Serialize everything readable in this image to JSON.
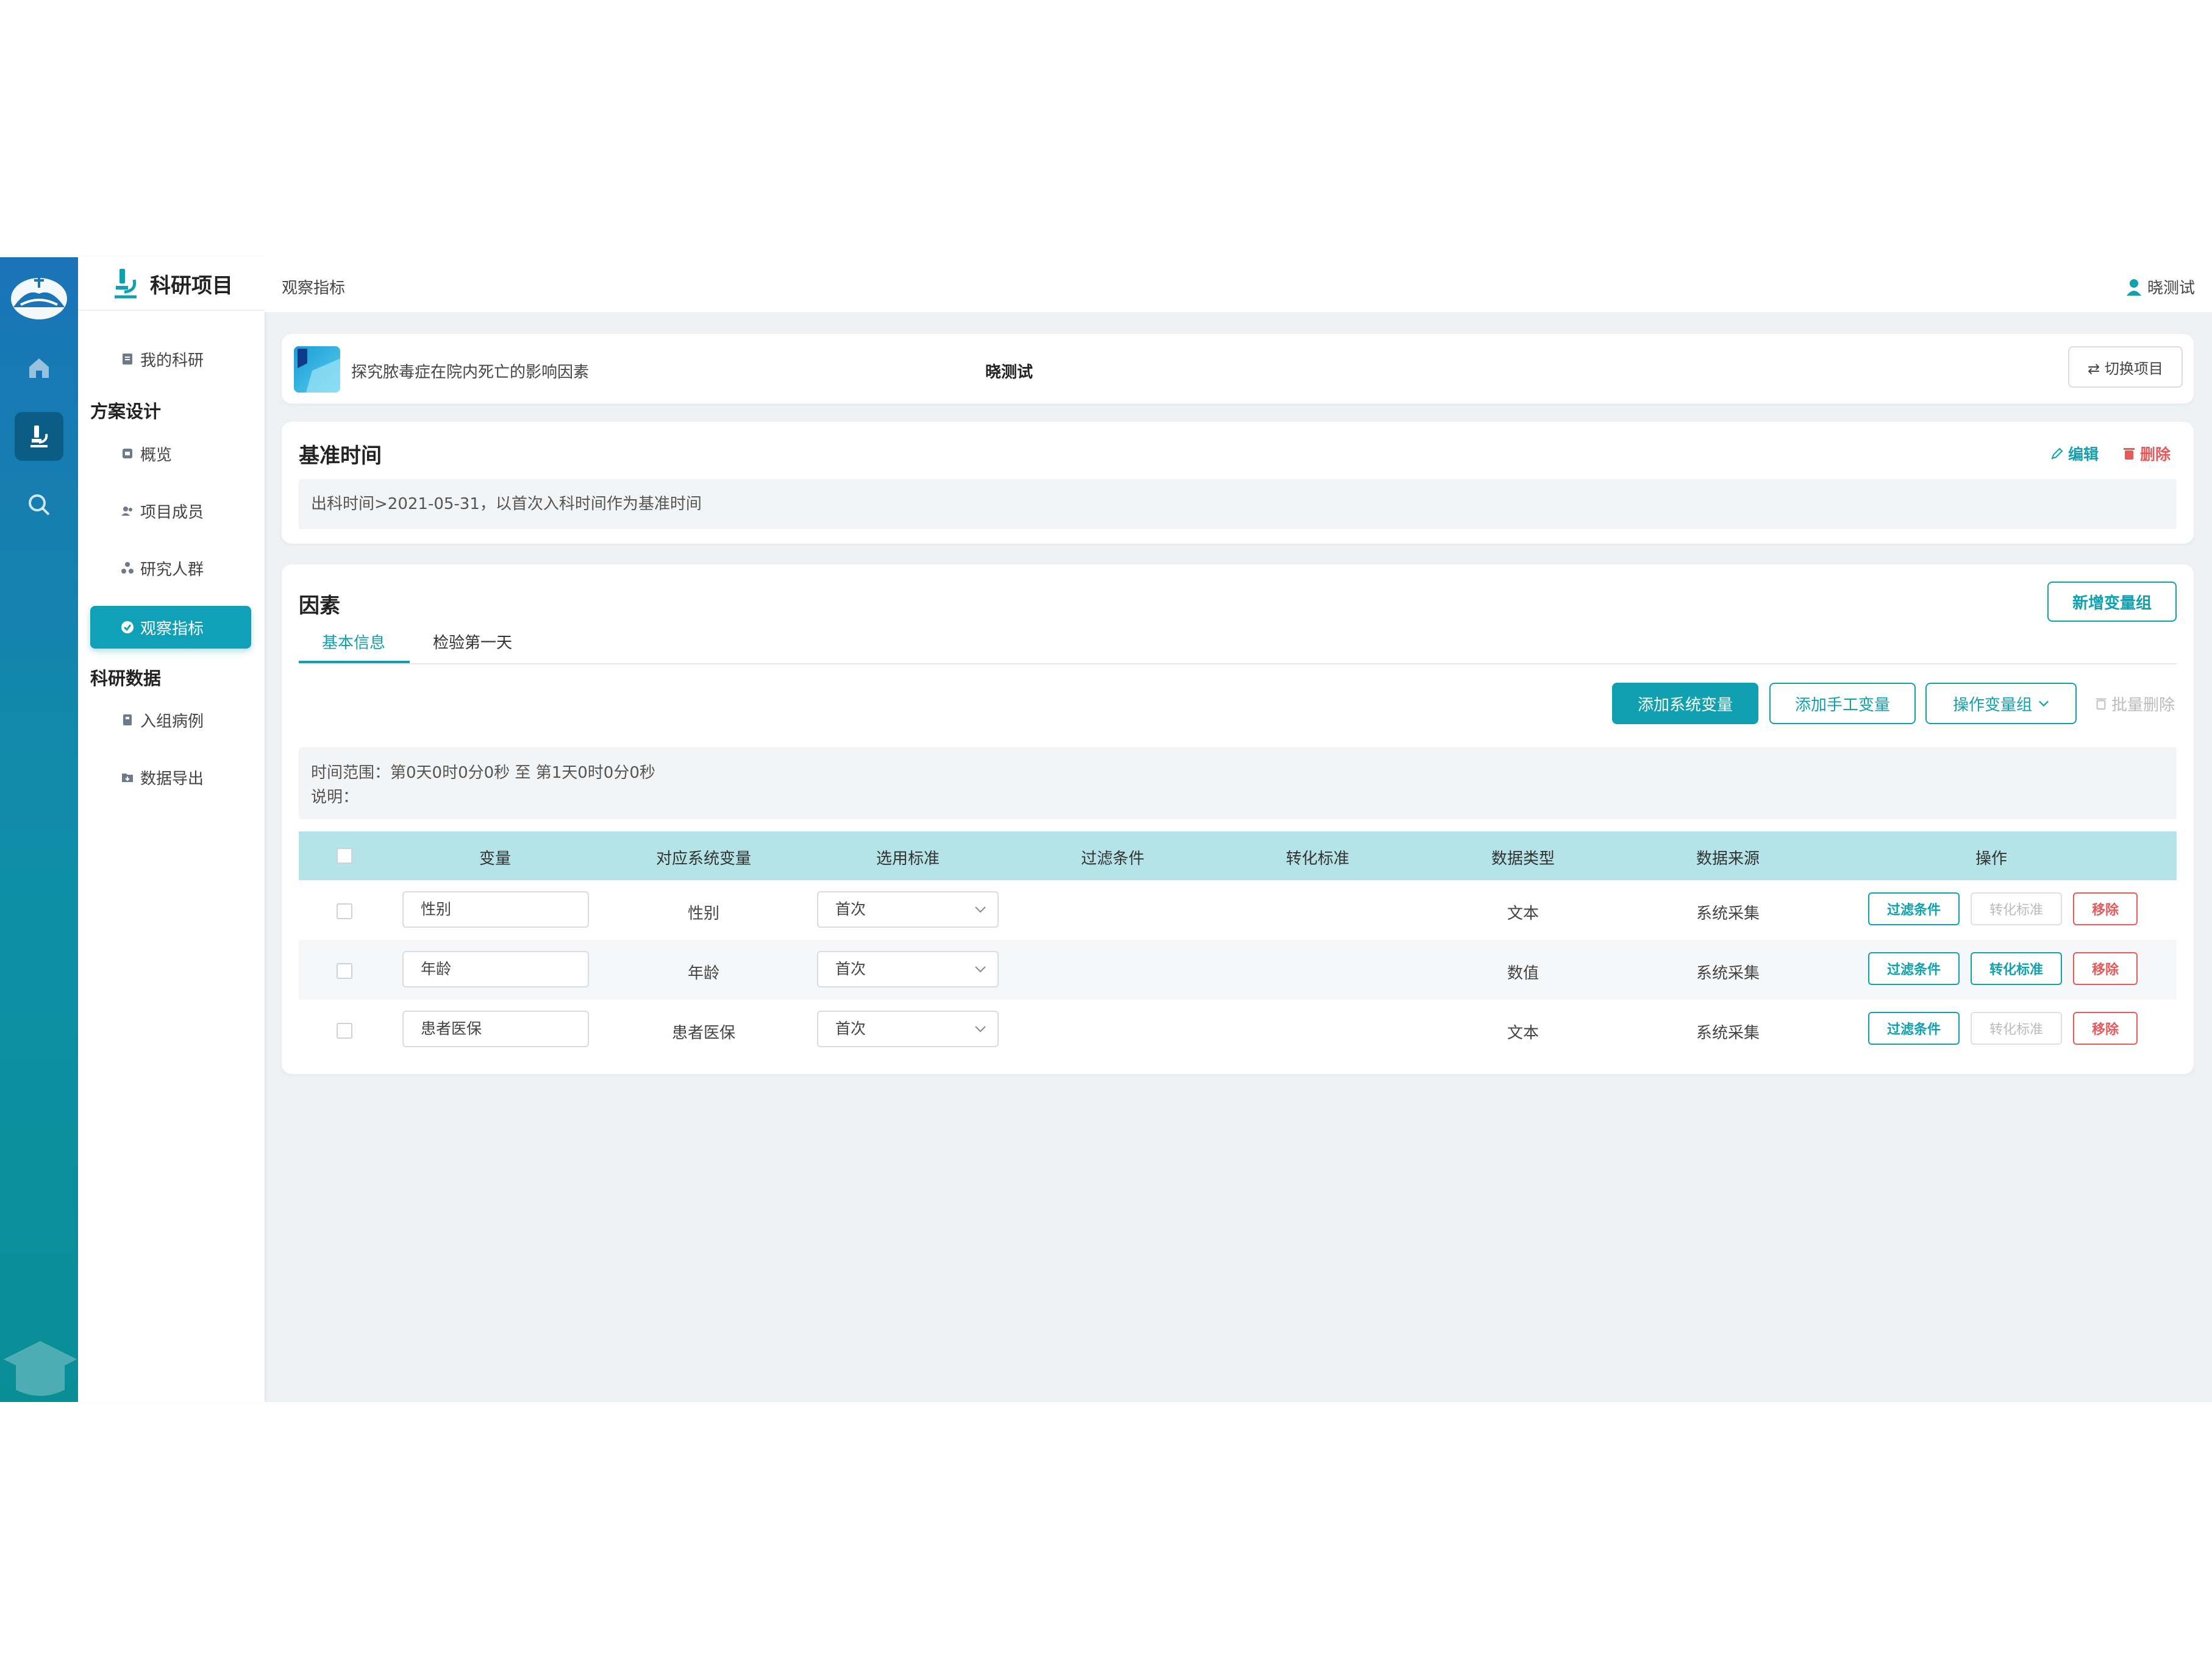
{
  "colors": {
    "accent": "#10a0b0",
    "danger": "#e85a5a",
    "header_row": "#b4e3e8",
    "rail": "#1a74b7"
  },
  "rail": {
    "items": [
      "home-icon",
      "microscope-icon",
      "search-icon"
    ],
    "active": "microscope-icon"
  },
  "sidebar": {
    "title": "科研项目",
    "my_research": "我的科研",
    "section_design": "方案设计",
    "design_items": [
      {
        "label": "概览",
        "icon": "overview-icon"
      },
      {
        "label": "项目成员",
        "icon": "members-icon"
      },
      {
        "label": "研究人群",
        "icon": "population-icon"
      },
      {
        "label": "观察指标",
        "icon": "indicator-icon",
        "active": true
      }
    ],
    "section_data": "科研数据",
    "data_items": [
      {
        "label": "入组病例",
        "icon": "cases-icon"
      },
      {
        "label": "数据导出",
        "icon": "export-icon"
      }
    ]
  },
  "header": {
    "breadcrumb": "观察指标",
    "user": "晓测试"
  },
  "project": {
    "name": "探究脓毒症在院内死亡的影响因素",
    "owner": "晓测试",
    "switch_label": "⇄ 切换项目"
  },
  "baseline": {
    "title": "基准时间",
    "edit_label": "编辑",
    "delete_label": "删除",
    "description": "出科时间>2021-05-31，以首次入科时间作为基准时间"
  },
  "factors": {
    "title": "因素",
    "add_group_label": "新增变量组",
    "tabs": [
      "基本信息",
      "检验第一天"
    ],
    "active_tab": 0,
    "toolbar": {
      "add_system": "添加系统变量",
      "add_manual": "添加手工变量",
      "operate_group": "操作变量组",
      "batch_delete": "批量删除"
    },
    "time_range": "时间范围：第0天0时0分0秒 至 第1天0时0分0秒",
    "remark": "说明：",
    "columns": [
      "变量",
      "对应系统变量",
      "选用标准",
      "过滤条件",
      "转化标准",
      "数据类型",
      "数据来源",
      "操作"
    ],
    "rows": [
      {
        "variable": "性别",
        "system_var": "性别",
        "standard": "首次",
        "filter": "",
        "convert": "",
        "type": "文本",
        "source": "系统采集",
        "convert_enabled": false
      },
      {
        "variable": "年龄",
        "system_var": "年龄",
        "standard": "首次",
        "filter": "",
        "convert": "",
        "type": "数值",
        "source": "系统采集",
        "convert_enabled": true
      },
      {
        "variable": "患者医保",
        "system_var": "患者医保",
        "standard": "首次",
        "filter": "",
        "convert": "",
        "type": "文本",
        "source": "系统采集",
        "convert_enabled": false
      }
    ],
    "row_actions": {
      "filter": "过滤条件",
      "convert": "转化标准",
      "remove": "移除"
    }
  }
}
